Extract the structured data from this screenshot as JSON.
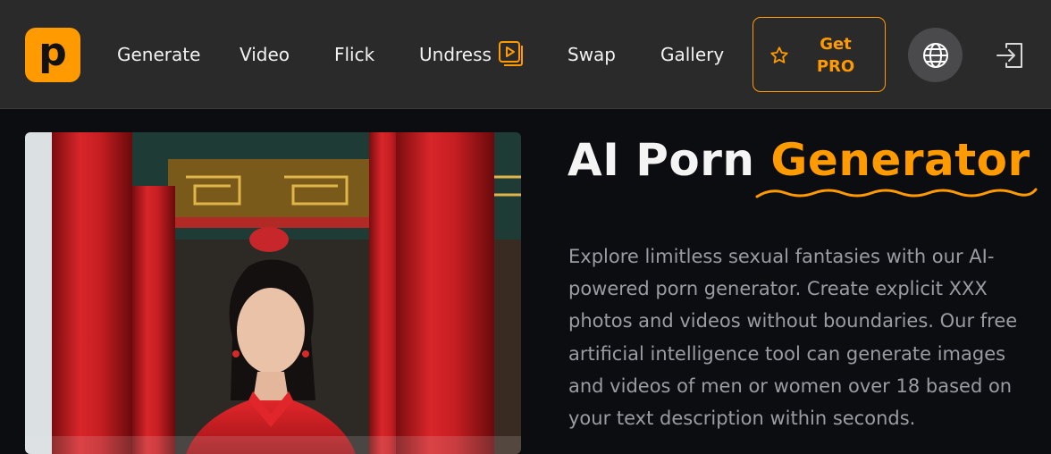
{
  "brand": {
    "logo_letter": "p"
  },
  "nav": {
    "items": [
      {
        "label": "Generate"
      },
      {
        "label": "Video"
      },
      {
        "label": "Flick"
      },
      {
        "label": "Undress"
      },
      {
        "label": "Swap"
      },
      {
        "label": "Gallery"
      }
    ],
    "pro_line1": "Get",
    "pro_line2": "PRO",
    "icons": {
      "undress": "video-play-icon",
      "pro": "star-icon",
      "language": "globe-icon",
      "login": "login-icon"
    }
  },
  "hero": {
    "title_main": "AI Porn ",
    "title_accent": "Generator",
    "description": "Explore limitless sexual fantasies with our AI-powered porn generator. Create explicit XXX photos and videos without boundaries. Our free artificial intelligence tool can generate images and videos of men or women over 18 based on your text description within seconds."
  },
  "colors": {
    "accent": "#ff9a00",
    "nav_bg": "#2a2a2b",
    "page_bg": "#0c0d10",
    "text_muted": "#9a9ca4"
  }
}
